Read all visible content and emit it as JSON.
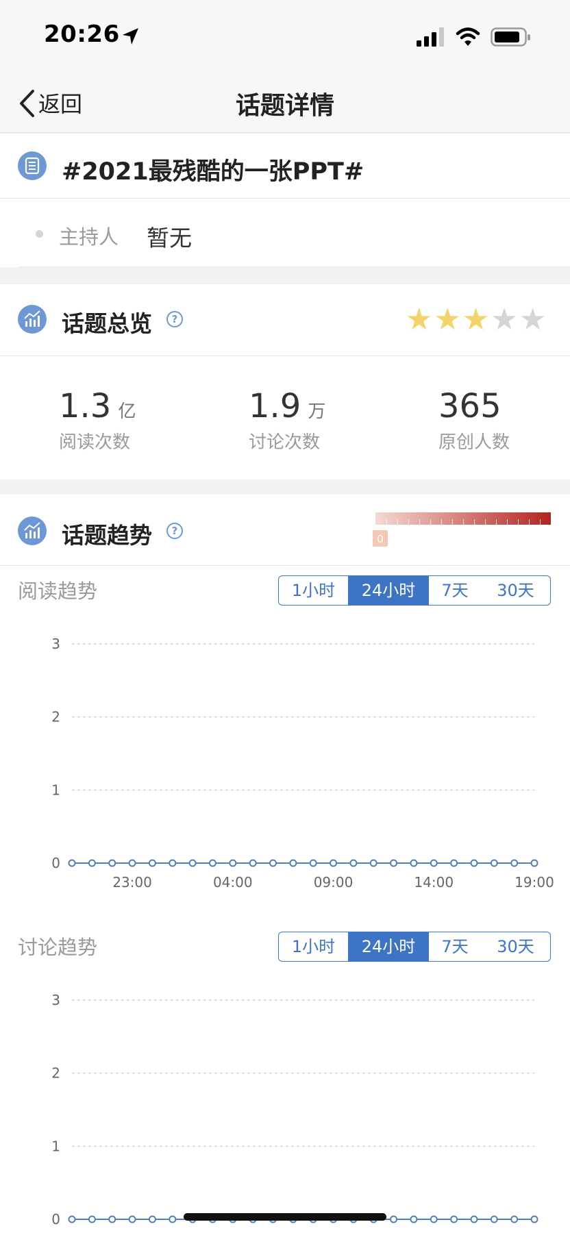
{
  "status_bar": {
    "time": "20:26"
  },
  "nav": {
    "back_label": "返回",
    "title": "话题详情"
  },
  "topic": {
    "title": "#2021最残酷的一张PPT#",
    "host_label": "主持人",
    "host_value": "暂无"
  },
  "overview": {
    "title": "话题总览",
    "rating": {
      "value": 3,
      "max": 5,
      "filled_color": "#f3d36a",
      "empty_color": "#d5d5d5"
    },
    "stats": [
      {
        "num": "1.3",
        "unit": "亿",
        "label": "阅读次数"
      },
      {
        "num": "1.9",
        "unit": "万",
        "label": "讨论次数"
      },
      {
        "num": "365",
        "unit": "",
        "label": "原创人数"
      }
    ]
  },
  "trend": {
    "title": "话题趋势",
    "legend_marker": "0",
    "tabs": [
      "1小时",
      "24小时",
      "7天",
      "30天"
    ],
    "active_tab": 1
  },
  "chart_data": [
    {
      "type": "line",
      "title": "阅读趋势",
      "xlabel": "",
      "ylabel": "",
      "ylim": [
        0,
        3
      ],
      "yticks": [
        "3",
        "2",
        "1",
        "0"
      ],
      "xticks": [
        "23:00",
        "04:00",
        "09:00",
        "14:00",
        "19:00"
      ],
      "x": [
        "",
        "",
        "",
        "",
        "",
        "",
        "",
        "",
        "",
        "",
        "",
        "",
        "",
        "",
        "",
        "",
        "",
        "",
        "",
        "",
        "",
        "",
        "",
        ""
      ],
      "series": [
        {
          "values": [
            0,
            0,
            0,
            0,
            0,
            0,
            0,
            0,
            0,
            0,
            0,
            0,
            0,
            0,
            0,
            0,
            0,
            0,
            0,
            0,
            0,
            0,
            0,
            0
          ]
        }
      ],
      "grid": true,
      "color": "#4f7fc3"
    },
    {
      "type": "line",
      "title": "讨论趋势",
      "xlabel": "",
      "ylabel": "",
      "ylim": [
        0,
        3
      ],
      "yticks": [
        "3",
        "2",
        "1",
        "0"
      ],
      "xticks": [],
      "x": [
        "",
        "",
        "",
        "",
        "",
        "",
        "",
        "",
        "",
        "",
        "",
        "",
        "",
        "",
        "",
        "",
        "",
        "",
        "",
        "",
        "",
        "",
        "",
        ""
      ],
      "series": [
        {
          "values": [
            0,
            0,
            0,
            0,
            0,
            0,
            0,
            0,
            0,
            0,
            0,
            0,
            0,
            0,
            0,
            0,
            0,
            0,
            0,
            0,
            0,
            0,
            0,
            0
          ]
        }
      ],
      "grid": true,
      "color": "#4f7fc3"
    }
  ]
}
